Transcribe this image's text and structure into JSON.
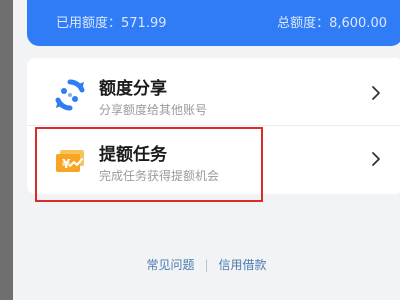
{
  "credit": {
    "used_label": "已用额度：571.99",
    "total_label": "总额度：8,600.00"
  },
  "menu": {
    "items": [
      {
        "title": "额度分享",
        "desc": "分享额度给其他账号",
        "icon": "share-cycle-icon"
      },
      {
        "title": "提额任务",
        "desc": "完成任务获得提额机会",
        "icon": "money-task-icon"
      }
    ]
  },
  "footer": {
    "link_faq": "常见问题",
    "separator": "|",
    "link_credit_loan": "信用借款"
  },
  "colors": {
    "brand_blue": "#2f7cf6",
    "highlight_red": "#d92b2b",
    "task_orange": "#f6a623"
  }
}
